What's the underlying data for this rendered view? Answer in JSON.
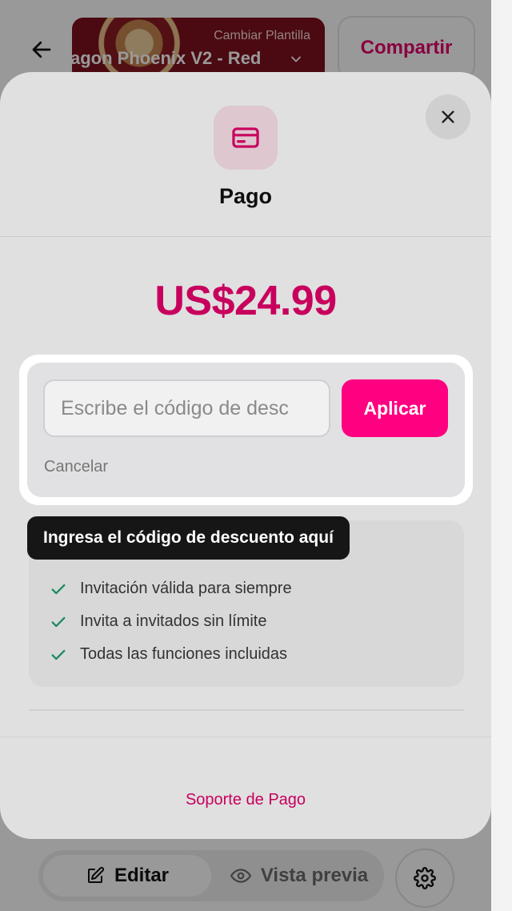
{
  "colors": {
    "accent": "#e4006a",
    "apply_button": "#ff0080",
    "check": "#1f9d6b",
    "template_bg": "#7e0f1d"
  },
  "topbar": {
    "back_icon": "arrow-left-icon",
    "template_subtitle": "Cambiar Plantilla",
    "template_name": "agon Phoenix V2 - Red",
    "template_chevron_icon": "chevron-down-icon",
    "share_label": "Compartir"
  },
  "modal": {
    "close_icon": "close-icon",
    "payment_icon": "credit-card-icon",
    "title": "Pago",
    "price": "US$24.99",
    "discount": {
      "placeholder": "Escribe el código de desc",
      "value": "",
      "apply_label": "Aplicar",
      "cancel_label": "Cancelar"
    },
    "tooltip": "Ingresa el código de descuento aquí",
    "features": [
      {
        "icon": "check-icon",
        "label": "Invitación válida para siempre"
      },
      {
        "icon": "check-icon",
        "label": "Invita a invitados sin límite"
      },
      {
        "icon": "check-icon",
        "label": "Todas las funciones incluidas"
      }
    ],
    "support_label": "Soporte de Pago"
  },
  "bottombar": {
    "edit_label": "Editar",
    "edit_icon": "edit-icon",
    "preview_label": "Vista previa",
    "preview_icon": "eye-icon",
    "settings_icon": "gear-icon"
  }
}
